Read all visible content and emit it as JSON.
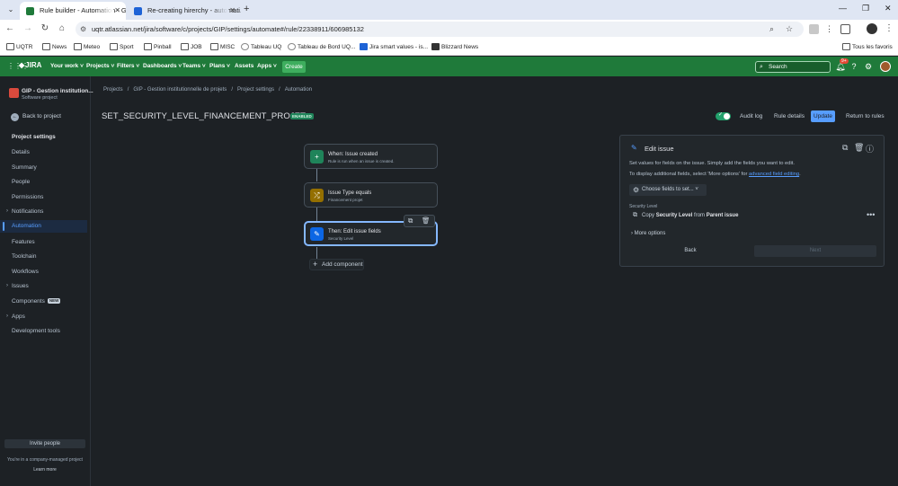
{
  "browser": {
    "tabs": [
      {
        "title": "Rule builder - Automation - GIP",
        "active": true
      },
      {
        "title": "Re-creating hirerchy - automati...",
        "active": false
      }
    ],
    "url": "uqtr.atlassian.net/jira/software/c/projects/GIP/settings/automate#/rule/22338911/606985132",
    "bookmarks": [
      "UQTR",
      "News",
      "Meteo",
      "Sport",
      "Pinball",
      "JOB",
      "MISC",
      "Tableau UQ",
      "Tableau de Bord UQ...",
      "Jira smart values - is...",
      "Blizzard News"
    ],
    "all_bookmarks": "Tous les favoris"
  },
  "jira_nav": {
    "logo": "JIRA",
    "items": [
      "Your work",
      "Projects",
      "Filters",
      "Dashboards",
      "Teams",
      "Plans",
      "Assets",
      "Apps"
    ],
    "create_label": "Create",
    "search_placeholder": "Search",
    "notification_count": "9+"
  },
  "sidebar": {
    "project_name": "GIP - Gestion institution...",
    "project_type": "Software project",
    "back_label": "Back to project",
    "section_title": "Project settings",
    "items": [
      {
        "label": "Details"
      },
      {
        "label": "Summary"
      },
      {
        "label": "People"
      },
      {
        "label": "Permissions"
      },
      {
        "label": "Notifications"
      },
      {
        "label": "Automation"
      },
      {
        "label": "Features"
      },
      {
        "label": "Toolchain"
      },
      {
        "label": "Workflows"
      },
      {
        "label": "Issues"
      },
      {
        "label": "Components",
        "badge": "NEW"
      },
      {
        "label": "Apps"
      },
      {
        "label": "Development tools"
      }
    ],
    "invite_label": "Invite people",
    "company_note": "You're in a company-managed project",
    "learn_more": "Learn more"
  },
  "breadcrumb": [
    "Projects",
    "GIP - Gestion institutionnelle de projets",
    "Project settings",
    "Automation"
  ],
  "rule": {
    "title": "SET_SECURITY_LEVEL_FINANCEMENT_PROJET",
    "status_badge": "ENABLED",
    "audit_log": "Audit log",
    "rule_details": "Rule details",
    "update": "Update",
    "return_to_rules": "Return to rules"
  },
  "flow": {
    "nodes": [
      {
        "title": "When: Issue created",
        "subtitle": "Rule is run when an issue is created.",
        "color": "#1f845a",
        "icon": "plus-icon"
      },
      {
        "title": "Issue Type equals",
        "subtitle": "Financement projet",
        "color": "#946f00",
        "icon": "shuffle-icon"
      },
      {
        "title": "Then: Edit issue fields",
        "subtitle": "Security Level",
        "color": "#0c66e4",
        "icon": "pencil-icon"
      }
    ],
    "add_component": "Add component"
  },
  "edit_panel": {
    "title": "Edit issue",
    "desc1": "Set values for fields on the issue. Simply add the fields you want to edit.",
    "desc2_prefix": "To display additional fields, select 'More options' for ",
    "desc2_link": "advanced field editing",
    "desc2_suffix": ".",
    "choose_fields": "Choose fields to set...",
    "field_label": "Security Level",
    "copy_word": "Copy",
    "field_name": "Security Level",
    "from_word": "from",
    "source": "Parent issue",
    "more_options": "More options",
    "back": "Back",
    "next": "Next"
  }
}
